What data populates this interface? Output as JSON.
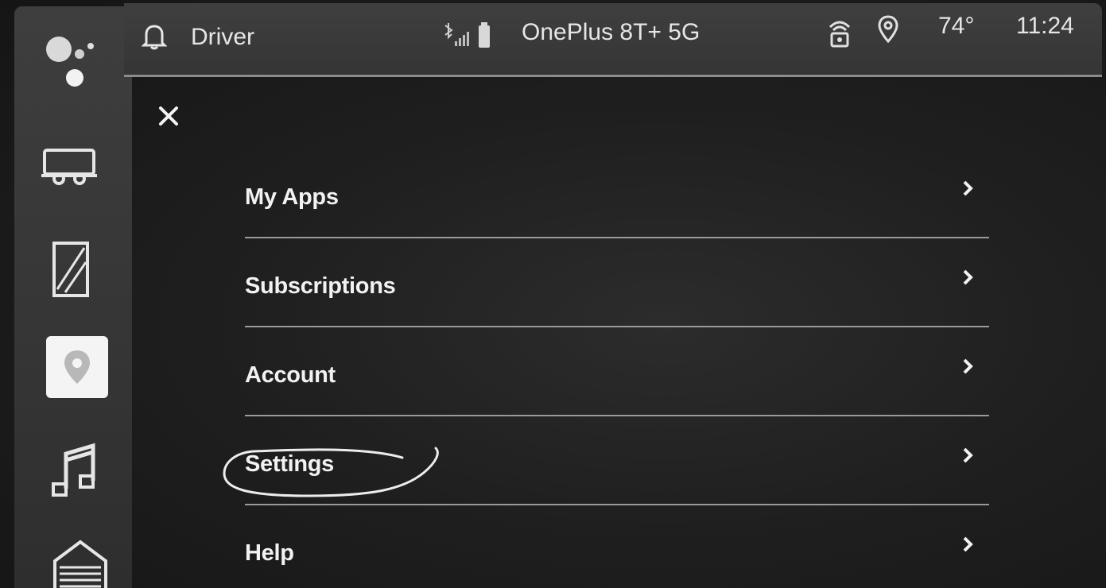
{
  "status_bar": {
    "profile_name": "Driver",
    "phone_name": "OnePlus 8T+ 5G",
    "temperature": "74°",
    "time": "11:24"
  },
  "rail": {
    "items": [
      {
        "icon": "assistant-icon"
      },
      {
        "icon": "vehicle-icon"
      },
      {
        "icon": "window-panel-icon"
      },
      {
        "icon": "navigation-pin-icon",
        "selected": true
      },
      {
        "icon": "music-note-icon"
      },
      {
        "icon": "building-icon"
      }
    ]
  },
  "menu": {
    "items": [
      {
        "label": "My Apps"
      },
      {
        "label": "Subscriptions"
      },
      {
        "label": "Account"
      },
      {
        "label": "Settings",
        "annotated": true
      },
      {
        "label": "Help"
      }
    ]
  },
  "colors": {
    "background": "#1f1f1f",
    "bar": "#3a3a3a",
    "text": "#f2f2f2",
    "divider": "#9a9a9a"
  }
}
